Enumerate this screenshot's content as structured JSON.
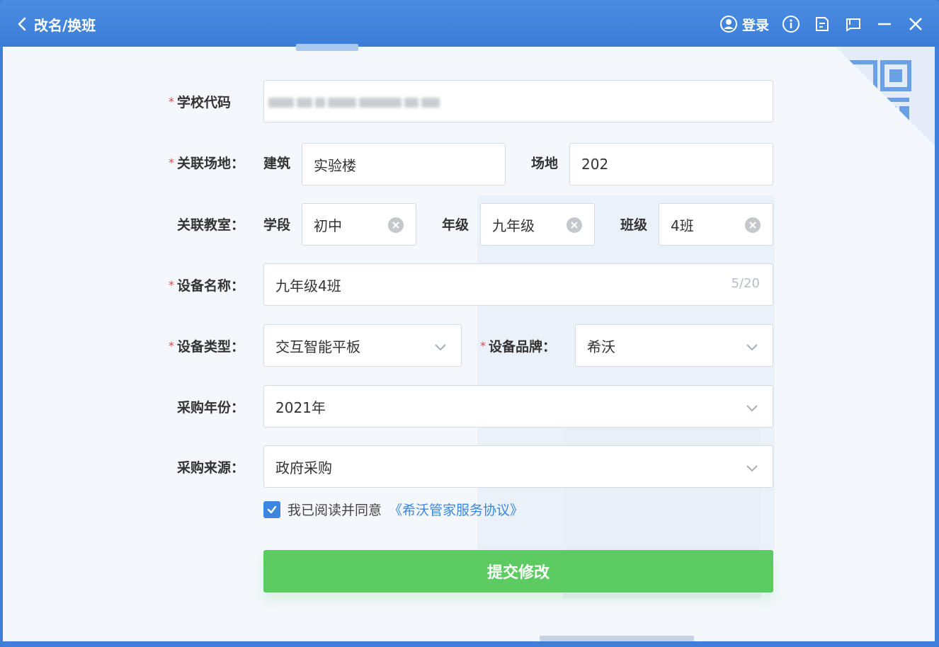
{
  "window": {
    "title": "改名/换班"
  },
  "titlebar": {
    "login_label": "登录",
    "icons": [
      "user-circle-icon",
      "info-icon",
      "edit-icon",
      "skin-icon",
      "minimize-icon",
      "close-icon"
    ]
  },
  "form": {
    "school_code": {
      "label": "学校代码"
    },
    "venue": {
      "label": "关联场地：",
      "building_label": "建筑",
      "building_value": "实验楼",
      "place_label": "场地",
      "place_value": "202"
    },
    "classroom": {
      "label": "关联教室：",
      "stage_label": "学段",
      "stage_value": "初中",
      "grade_label": "年级",
      "grade_value": "九年级",
      "class_label": "班级",
      "class_value": "4班"
    },
    "device_name": {
      "label": "设备名称：",
      "value": "九年级4班",
      "counter": "5/20"
    },
    "device_type": {
      "label": "设备类型：",
      "value": "交互智能平板"
    },
    "device_brand": {
      "label": "设备品牌：",
      "value": "希沃"
    },
    "purchase_year": {
      "label": "采购年份：",
      "value": "2021年"
    },
    "purchase_source": {
      "label": "采购来源：",
      "value": "政府采购"
    },
    "agreement": {
      "text": "我已阅读并同意",
      "link": "《希沃管家服务协议》",
      "checked": true
    },
    "submit_label": "提交修改"
  },
  "colors": {
    "titlebar": "#3b7ed9",
    "accent": "#3a86e2",
    "submit": "#5ccb62",
    "required": "#e04848"
  }
}
